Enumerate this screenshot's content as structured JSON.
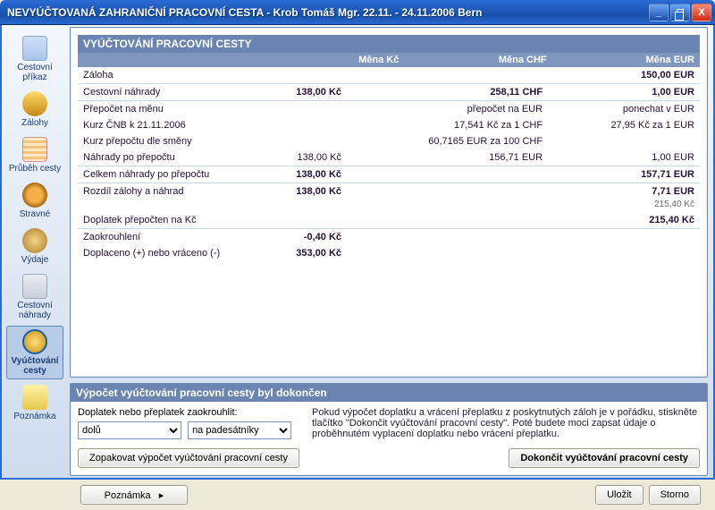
{
  "window": {
    "title": "NEVYÚČTOVANÁ ZAHRANIČNÍ PRACOVNÍ CESTA - Krob Tomáš Mgr. 22.11. - 24.11.2006  Bern",
    "min": "_",
    "close": "X"
  },
  "sidebar": {
    "items": [
      {
        "label": "Cestovní příkaz"
      },
      {
        "label": "Zálohy"
      },
      {
        "label": "Průběh cesty"
      },
      {
        "label": "Stravné"
      },
      {
        "label": "Výdaje"
      },
      {
        "label": "Cestovní náhrady"
      },
      {
        "label": "Vyúčtování cesty"
      },
      {
        "label": "Poznámka"
      }
    ]
  },
  "sheet": {
    "title": "VYÚČTOVÁNÍ PRACOVNÍ CESTY",
    "col1": "Měna Kč",
    "col2": "Měna CHF",
    "col3": "Měna EUR",
    "r_zaloha": "Záloha",
    "r_zaloha_eur": "150,00 EUR",
    "r_nahrady": "Cestovní náhrady",
    "r_nahrady_kc": "138,00 Kč",
    "r_nahrady_chf": "258,11 CHF",
    "r_nahrady_eur": "1,00 EUR",
    "r_prepocet": "Přepočet na měnu",
    "r_prepocet_chf": "přepočet na EUR",
    "r_prepocet_eur": "ponechat v EUR",
    "r_kurz": "Kurz ČNB k 21.11.2006",
    "r_kurz_chf": "17,541 Kč za 1 CHF",
    "r_kurz_eur": "27,95 Kč za 1 EUR",
    "r_kurzsmeny": "Kurz přepočtu dle směny",
    "r_kurzsmeny_chf": "60,7165 EUR za 100 CHF",
    "r_nahrady_po": "Náhrady po přepočtu",
    "r_nahrady_po_kc": "138,00 Kč",
    "r_nahrady_po_chf": "156,71 EUR",
    "r_nahrady_po_eur": "1,00 EUR",
    "r_celkem": "Celkem náhrady po přepočtu",
    "r_celkem_kc": "138,00 Kč",
    "r_celkem_eur": "157,71 EUR",
    "r_rozdil": "Rozdíl zálohy a náhrad",
    "r_rozdil_kc": "138,00 Kč",
    "r_rozdil_eur": "7,71 EUR",
    "r_rozdil_eur_sub": "215,40 Kč",
    "r_doplatek": "Doplatek přepočten na Kč",
    "r_doplatek_kc": "215,40 Kč",
    "r_zaokr": "Zaokrouhlení",
    "r_zaokr_kc": "-0,40 Kč",
    "r_doplaceno": "Doplaceno (+) nebo vráceno (-)",
    "r_doplaceno_kc": "353,00 Kč"
  },
  "bottom": {
    "title": "Výpočet vyúčtování pracovní cesty byl dokončen",
    "round_label": "Doplatek nebo přeplatek zaokrouhlit:",
    "sel1": "dolů",
    "sel2": "na padesátníky",
    "info": "Pokud výpočet doplatku a vrácení přeplatku z poskytnutých záloh je v pořádku, stiskněte tlačítko \"Dokončit vyúčtování pracovní cesty\". Poté budete moci zapsat údaje o proběhnutém vyplacení doplatku nebo vrácení přeplatku.",
    "btn_repeat": "Zopakovat výpočet vyúčtování pracovní cesty",
    "btn_finish": "Dokončit vyúčtování pracovní cesty"
  },
  "footer": {
    "btn_note": "Poznámka",
    "btn_save": "Uložit",
    "btn_cancel": "Storno"
  }
}
